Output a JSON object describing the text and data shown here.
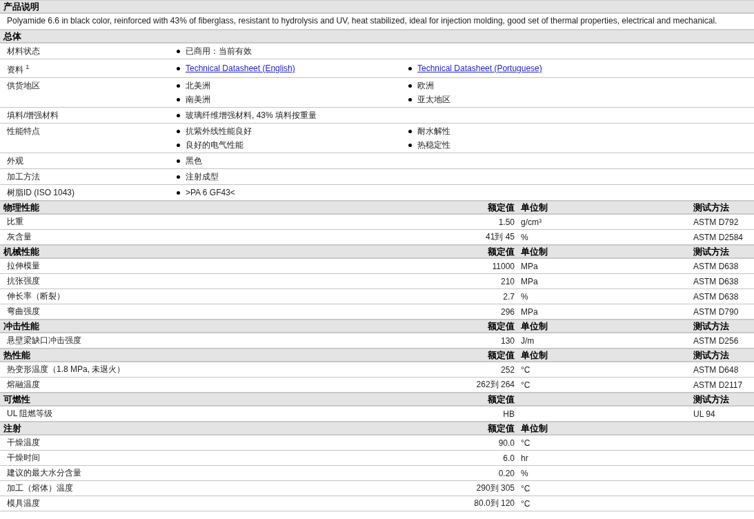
{
  "sections": [
    {
      "kind": "text",
      "title": "产品说明",
      "text": "Polyamide 6.6 in black color, reinforced with 43% of fiberglass, resistant to hydrolysis and UV, heat stabilized, ideal for injection molding, good set of thermal properties, electrical and mechanical."
    },
    {
      "kind": "general",
      "title": "总体",
      "rows": [
        {
          "label": "材料状态",
          "items": [
            {
              "kind": "text",
              "text": "已商用：当前有效"
            }
          ]
        },
        {
          "label": "资料 $^{1}$",
          "items": [
            {
              "kind": "link",
              "text": "Technical Datasheet (English)"
            },
            {
              "kind": "link",
              "text": "Technical Datasheet (Portuguese)"
            }
          ]
        },
        {
          "label": "供货地区",
          "items": [
            {
              "kind": "text",
              "text": "北美洲"
            },
            {
              "kind": "text",
              "text": "欧洲"
            },
            {
              "kind": "text",
              "text": "南美洲"
            },
            {
              "kind": "text",
              "text": "亚太地区"
            }
          ]
        },
        {
          "label": "填料/增强材料",
          "items": [
            {
              "kind": "text",
              "text": "玻璃纤维增强材料, 43% 填料按重量"
            }
          ]
        },
        {
          "label": "性能特点",
          "items": [
            {
              "kind": "text",
              "text": "抗紫外线性能良好"
            },
            {
              "kind": "text",
              "text": "耐水解性"
            },
            {
              "kind": "text",
              "text": "良好的电气性能"
            },
            {
              "kind": "text",
              "text": "热稳定性"
            }
          ]
        },
        {
          "label": "外观",
          "items": [
            {
              "kind": "text",
              "text": "黑色"
            }
          ]
        },
        {
          "label": "加工方法",
          "items": [
            {
              "kind": "text",
              "text": "注射成型"
            }
          ]
        },
        {
          "label": "树脂ID (ISO 1043)",
          "items": [
            {
              "kind": "text",
              "text": ">PA 6 GF43<"
            }
          ]
        }
      ]
    },
    {
      "kind": "properties",
      "title": "物理性能",
      "columns": {
        "value": "额定值",
        "unit": "单位制",
        "method": "测试方法"
      },
      "rows": [
        {
          "name": "比重",
          "value": "1.50",
          "unit": "g/cm³",
          "method": "ASTM D792"
        },
        {
          "name": "灰含量",
          "value": "41到 45",
          "unit": "%",
          "method": "ASTM D2584"
        }
      ]
    },
    {
      "kind": "properties",
      "title": "机械性能",
      "columns": {
        "value": "额定值",
        "unit": "单位制",
        "method": "测试方法"
      },
      "rows": [
        {
          "name": "拉伸模量",
          "value": "11000",
          "unit": "MPa",
          "method": "ASTM D638"
        },
        {
          "name": "抗张强度",
          "value": "210",
          "unit": "MPa",
          "method": "ASTM D638"
        },
        {
          "name": "伸长率（断裂）",
          "value": "2.7",
          "unit": "%",
          "method": "ASTM D638"
        },
        {
          "name": "弯曲强度",
          "value": "296",
          "unit": "MPa",
          "method": "ASTM D790"
        }
      ]
    },
    {
      "kind": "properties",
      "title": "冲击性能",
      "columns": {
        "value": "额定值",
        "unit": "单位制",
        "method": "测试方法"
      },
      "rows": [
        {
          "name": "悬壁梁缺口冲击强度",
          "value": "130",
          "unit": "J/m",
          "method": "ASTM D256"
        }
      ]
    },
    {
      "kind": "properties",
      "title": "热性能",
      "columns": {
        "value": "额定值",
        "unit": "单位制",
        "method": "测试方法"
      },
      "rows": [
        {
          "name": "热变形温度（1.8 MPa, 未退火）",
          "value": "252",
          "unit": "°C",
          "method": "ASTM D648"
        },
        {
          "name": "熔融温度",
          "value": "262到 264",
          "unit": "°C",
          "method": "ASTM D2117"
        }
      ]
    },
    {
      "kind": "properties",
      "title": "可燃性",
      "columns": {
        "value": "额定值",
        "method": "测试方法"
      },
      "rows": [
        {
          "name": "UL 阻燃等级",
          "value": "HB",
          "method": "UL 94"
        }
      ]
    },
    {
      "kind": "properties",
      "title": "注射",
      "columns": {
        "value": "额定值",
        "unit": "单位制"
      },
      "rows": [
        {
          "name": "干燥温度",
          "value": "90.0",
          "unit": "°C"
        },
        {
          "name": "干燥时间",
          "value": "6.0",
          "unit": "hr"
        },
        {
          "name": "建议的最大水分含量",
          "value": "0.20",
          "unit": "%"
        },
        {
          "name": "加工（熔体）温度",
          "value": "290到 305",
          "unit": "°C"
        },
        {
          "name": "模具温度",
          "value": "80.0到 120",
          "unit": "°C"
        }
      ]
    }
  ]
}
